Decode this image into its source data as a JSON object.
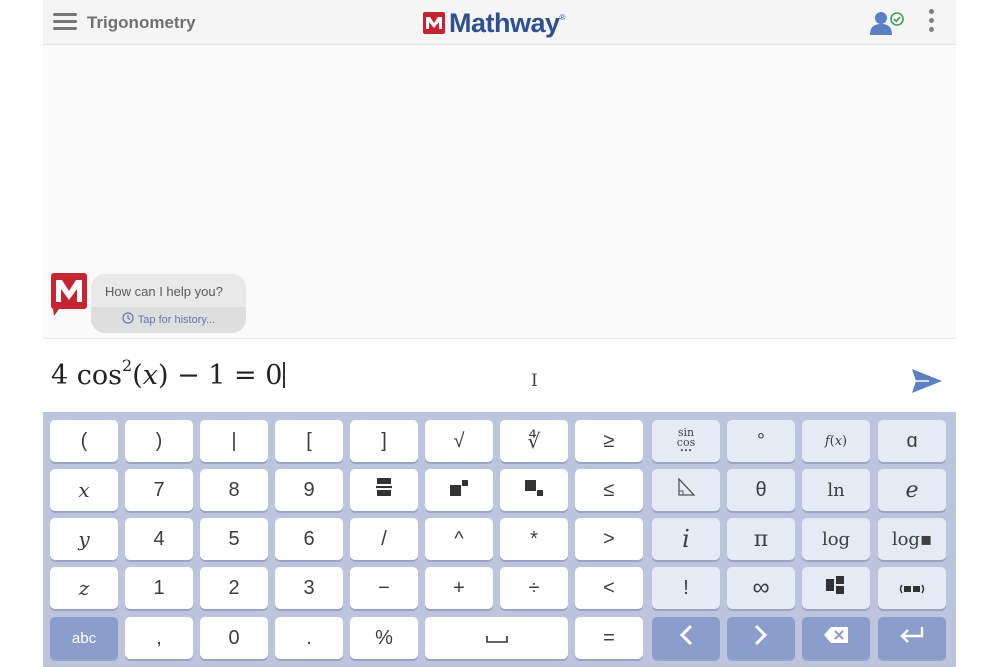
{
  "header": {
    "title": "Trigonometry",
    "brand": "Mathway",
    "brand_tm": "®"
  },
  "chat": {
    "message": "How can I help you?",
    "history_link": "Tap for history..."
  },
  "input": {
    "expression_prefix": "4 cos",
    "expression_exponent": "2",
    "expression_suffix": "(𝑥) − 1 = 0"
  },
  "keyboard": {
    "rows": [
      [
        "(",
        ")",
        "|",
        "[",
        "]",
        "√",
        "∜",
        "≥",
        "sin/cos",
        "°",
        "𝑓(𝑥)",
        "ɑ"
      ],
      [
        "𝑥",
        "7",
        "8",
        "9",
        "fraction",
        "superscript",
        "subscript",
        "≤",
        "triangle",
        "θ",
        "ln",
        "𝑒"
      ],
      [
        "𝑦",
        "4",
        "5",
        "6",
        "/",
        "^",
        "*",
        ">",
        "𝑖",
        "π",
        "log",
        "log▪"
      ],
      [
        "𝑧",
        "1",
        "2",
        "3",
        "−",
        "+",
        "÷",
        "<",
        "!",
        "∞",
        "matrix",
        "vector"
      ],
      [
        "abc",
        ",",
        "0",
        ".",
        "%",
        "space",
        "=",
        "left-arrow",
        "right-arrow",
        "backspace",
        "enter"
      ]
    ],
    "sincos_top": "sin",
    "sincos_bottom": "cos",
    "sincos_dots": "•••"
  },
  "colors": {
    "brand_blue": "#2e4f92",
    "brand_red": "#c62430",
    "keyboard_bg": "#bcc5dd",
    "key_dark": "#8b9dcc",
    "send_blue": "#5b7fc4"
  },
  "icons": {
    "menu": "hamburger-icon",
    "user": "user-check-icon",
    "more": "kebab-icon",
    "send": "send-icon",
    "history": "clock-icon"
  }
}
